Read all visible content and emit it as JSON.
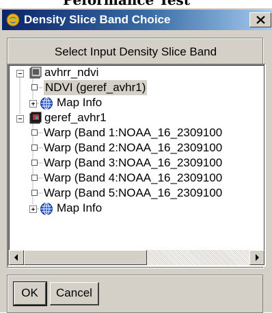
{
  "window": {
    "title": "Density Slice Band Choice",
    "close_label": "X"
  },
  "top_strip_text": "Peformance Test",
  "group": {
    "label": "Select Input Density Slice Band"
  },
  "tree": {
    "nodes": [
      {
        "label": "avhrr_ndvi",
        "type": "file"
      },
      {
        "label": "NDVI (geref_avhr1)",
        "type": "band",
        "selected": true
      },
      {
        "label": "Map Info",
        "type": "mapinfo"
      },
      {
        "label": "geref_avhr1",
        "type": "file"
      },
      {
        "label": "Warp (Band 1:NOAA_16_2309100",
        "type": "band"
      },
      {
        "label": "Warp (Band 2:NOAA_16_2309100",
        "type": "band"
      },
      {
        "label": "Warp (Band 3:NOAA_16_2309100",
        "type": "band"
      },
      {
        "label": "Warp (Band 4:NOAA_16_2309100",
        "type": "band"
      },
      {
        "label": "Warp (Band 5:NOAA_16_2309100",
        "type": "band"
      },
      {
        "label": "Map Info",
        "type": "mapinfo"
      }
    ]
  },
  "buttons": {
    "ok": "OK",
    "cancel": "Cancel"
  },
  "colors": {
    "title_start": "#0a246a",
    "title_end": "#a6caf0",
    "face": "#d4d0c8",
    "selection": "#d4d0c8"
  },
  "icons": [
    "app-icon",
    "close-icon",
    "raster-file-icon",
    "band-icon",
    "globe-icon",
    "scroll-left-icon",
    "scroll-right-icon"
  ]
}
